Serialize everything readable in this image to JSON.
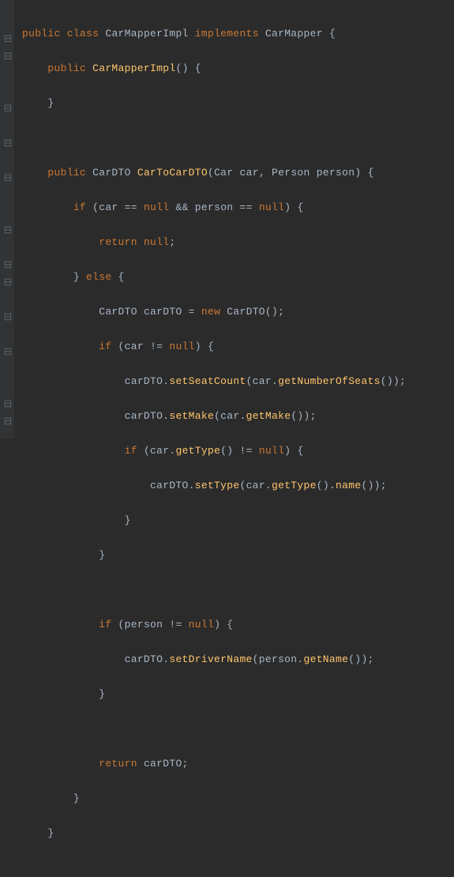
{
  "keywords": {
    "public": "public",
    "class": "class",
    "implements": "implements",
    "if": "if",
    "else": "else",
    "return": "return",
    "null": "null",
    "new": "new"
  },
  "types": {
    "CarMapperImpl": "CarMapperImpl",
    "CarMapper": "CarMapper",
    "CarDTO": "CarDTO",
    "Car": "Car",
    "Person": "Person"
  },
  "identifiers": {
    "car": "car",
    "person": "person",
    "carDTO": "carDTO"
  },
  "methods": {
    "CarMapperImpl": "CarMapperImpl",
    "CarToCarDTO": "CarToCarDTO",
    "setSeatCount": "setSeatCount",
    "getNumberOfSeats": "getNumberOfSeats",
    "setMake": "setMake",
    "getMake": "getMake",
    "getType": "getType",
    "setType": "setType",
    "name": "name",
    "setDriverName": "setDriverName",
    "getName": "getName"
  },
  "punct": {
    "obrace": "{",
    "cbrace": "}",
    "oparen": "(",
    "cparen": ")",
    "comma": ",",
    "semi": ";",
    "dot": ".",
    "eqeq": "==",
    "neq": "!=",
    "andand": "&&",
    "eq": "="
  },
  "gutter": {
    "fold_open": "⊟",
    "fold_close": "⊟"
  }
}
